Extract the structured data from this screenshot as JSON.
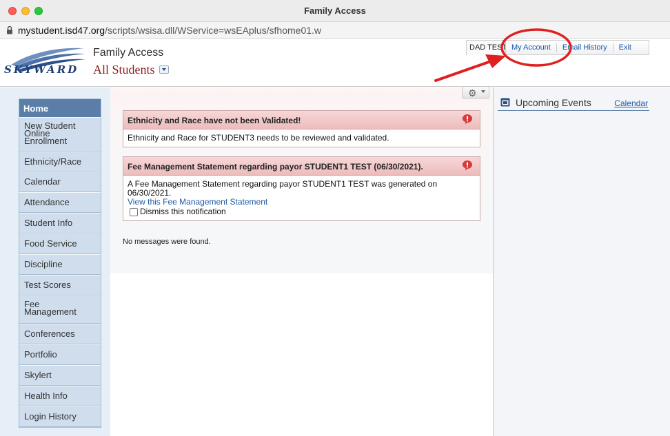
{
  "window": {
    "title": "Family Access"
  },
  "url": {
    "host": "mystudent.isd47.org",
    "path": "/scripts/wsisa.dll/WService=wsEAplus/sfhome01.w"
  },
  "header": {
    "logo_text": "SKYWARD",
    "app_title": "Family Access",
    "students_selector": "All Students",
    "user_name": "DAD TEST",
    "links": [
      "My Account",
      "Email History",
      "Exit"
    ]
  },
  "sidebar": {
    "home": "Home",
    "items": [
      "New Student Online Enrollment",
      "Ethnicity/Race",
      "Calendar",
      "Attendance",
      "Student Info",
      "Food Service",
      "Discipline",
      "Test Scores",
      "Fee Management",
      "Conferences",
      "Portfolio",
      "Skylert",
      "Health Info",
      "Login History"
    ]
  },
  "notices": [
    {
      "title": "Ethnicity and Race have not been Validated!",
      "body": "Ethnicity and Race for STUDENT3 needs to be reviewed and validated."
    },
    {
      "title": "Fee Management Statement regarding payor STUDENT1 TEST (06/30/2021).",
      "body": "A Fee Management Statement regarding payor STUDENT1 TEST was generated on 06/30/2021.",
      "link": "View this Fee Management Statement",
      "dismiss_label": "Dismiss this notification"
    }
  ],
  "messages": {
    "empty_text": "No messages were found."
  },
  "events": {
    "title": "Upcoming Events",
    "calendar_link": "Calendar"
  },
  "colors": {
    "annotation": "#e02020",
    "nav_active": "#5a7ea8",
    "link": "#1a5aa8",
    "alert_header": "#edbcbc"
  }
}
